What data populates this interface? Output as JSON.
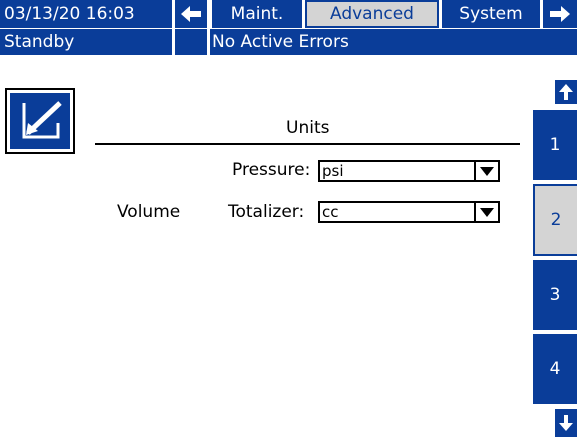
{
  "header": {
    "datetime": "03/13/20 16:03",
    "tabs": [
      {
        "label": "Maint.",
        "active": false
      },
      {
        "label": "Advanced",
        "active": true
      },
      {
        "label": "System",
        "active": false
      }
    ],
    "status": "Standby",
    "errors": "No Active Errors"
  },
  "main": {
    "section_title": "Units",
    "fields": {
      "pressure_label": "Pressure:",
      "pressure_value": "psi",
      "volume_label": "Volume",
      "totalizer_label": "Totalizer:",
      "totalizer_value": "cc"
    }
  },
  "side_tabs": [
    {
      "label": "1",
      "active": false
    },
    {
      "label": "2",
      "active": true
    },
    {
      "label": "3",
      "active": false
    },
    {
      "label": "4",
      "active": false
    }
  ],
  "colors": {
    "primary_blue": "#0a3d99",
    "active_tab_bg": "#d4d4d4"
  },
  "icons": {
    "edit": "edit-icon",
    "left": "arrow-left-icon",
    "right": "arrow-right-icon",
    "up": "arrow-up-icon",
    "down": "arrow-down-icon"
  }
}
